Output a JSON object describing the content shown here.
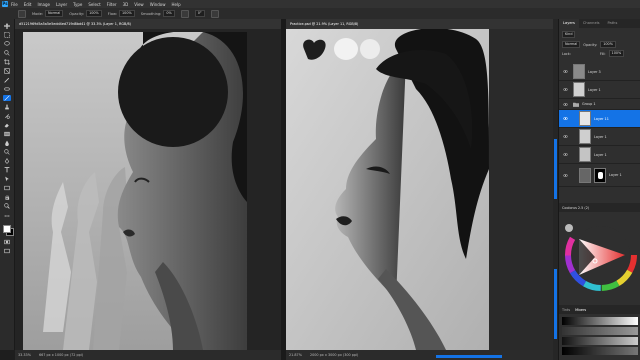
{
  "app": {
    "logo": "Ps"
  },
  "menu": [
    "File",
    "Edit",
    "Image",
    "Layer",
    "Type",
    "Select",
    "Filter",
    "3D",
    "View",
    "Window",
    "Help"
  ],
  "options": {
    "mode_label": "Mode:",
    "mode_value": "Normal",
    "opacity_label": "Opacity:",
    "opacity_value": "100%",
    "flow_label": "Flow:",
    "flow_value": "100%",
    "smoothing_label": "Smoothing:",
    "smoothing_value": "0%",
    "angle_value": "0°"
  },
  "docs": {
    "left_tab": "d5121969d5a5a5e5edd4ed719d8bd41 @ 33.3% (Layer 1, RGB/8)",
    "right_tab": "Practice.psd @ 21.9% (Layer 11, RGB/8)",
    "left_zoom": "33.33%",
    "left_size": "667 px x 1000 px (72 ppi)",
    "right_zoom": "21.87%",
    "right_size": "2000 px x 3000 px (300 ppi)"
  },
  "panel": {
    "tabs": [
      "Layers",
      "Channels",
      "Paths"
    ],
    "kind_label": "Kind",
    "blend_value": "Normal",
    "opacity_label": "Opacity:",
    "opacity_value": "100%",
    "lock_label": "Lock:",
    "fill_label": "Fill:",
    "fill_value": "100%",
    "layers": [
      {
        "name": "Layer 3",
        "selected": false
      },
      {
        "name": "Layer 1",
        "selected": false
      },
      {
        "name": "Group 1",
        "selected": false
      },
      {
        "name": "Layer 11",
        "selected": true
      },
      {
        "name": "Layer 1",
        "selected": false
      },
      {
        "name": "Layer 1",
        "selected": false
      },
      {
        "name": "Layer 1",
        "selected": false
      }
    ],
    "color_tabs": [
      "Coolorus 2.5 (2)"
    ],
    "swatch_tabs": [
      "Tints",
      "Mixers"
    ]
  },
  "colors": {
    "accent": "#1473e6",
    "ps_blue": "#31a8ff"
  }
}
